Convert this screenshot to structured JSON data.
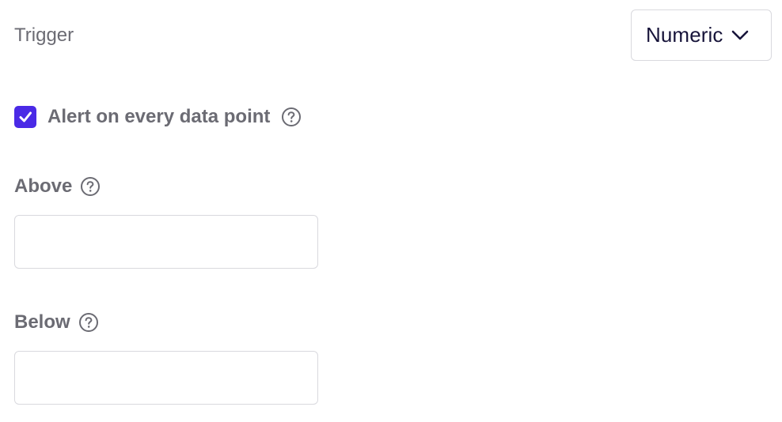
{
  "trigger": {
    "label": "Trigger",
    "select_value": "Numeric",
    "select_icon": "chevron-down-icon"
  },
  "alert_every_point": {
    "label": "Alert on every data point",
    "checked": true,
    "checkbox_color": "#4a2ae6",
    "help_icon": "question-circle-icon"
  },
  "above": {
    "label": "Above",
    "value": "",
    "placeholder": "",
    "help_icon": "question-circle-icon"
  },
  "below": {
    "label": "Below",
    "value": "",
    "placeholder": "",
    "help_icon": "question-circle-icon"
  }
}
